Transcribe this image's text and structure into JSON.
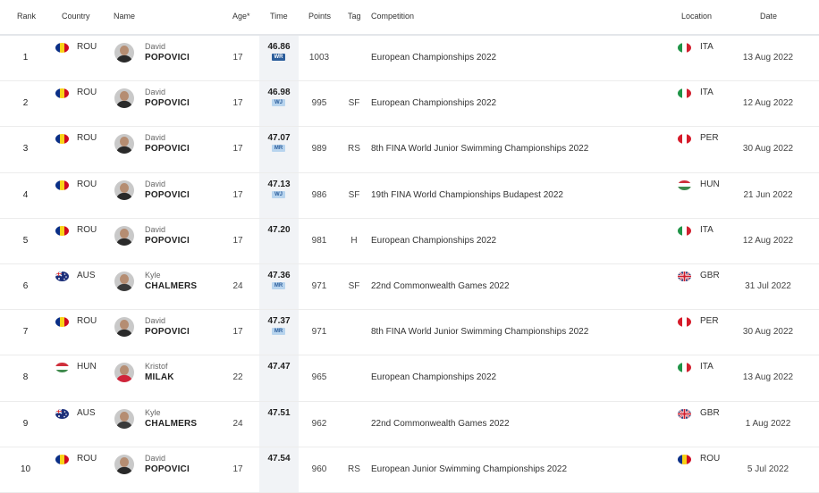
{
  "header": {
    "rank": "Rank",
    "country": "Country",
    "name": "Name",
    "age": "Age*",
    "time": "Time",
    "points": "Points",
    "tag": "Tag",
    "competition": "Competition",
    "location": "Location",
    "date": "Date"
  },
  "rows": [
    {
      "rank": "1",
      "country": "ROU",
      "country_flag": "flag-romania",
      "first": "David",
      "last": "POPOVICI",
      "age": "17",
      "time": "46.86",
      "record": "WR",
      "record_style": "strong",
      "points": "1003",
      "tag": "",
      "competition": "European Championships 2022",
      "location": "ITA",
      "location_flag": "flag-italy",
      "date": "13 Aug 2022"
    },
    {
      "rank": "2",
      "country": "ROU",
      "country_flag": "flag-romania",
      "first": "David",
      "last": "POPOVICI",
      "age": "17",
      "time": "46.98",
      "record": "WJ",
      "record_style": "light",
      "points": "995",
      "tag": "SF",
      "competition": "European Championships 2022",
      "location": "ITA",
      "location_flag": "flag-italy",
      "date": "12 Aug 2022"
    },
    {
      "rank": "3",
      "country": "ROU",
      "country_flag": "flag-romania",
      "first": "David",
      "last": "POPOVICI",
      "age": "17",
      "time": "47.07",
      "record": "MR",
      "record_style": "light",
      "points": "989",
      "tag": "RS",
      "competition": "8th FINA World Junior Swimming Championships 2022",
      "location": "PER",
      "location_flag": "flag-peru",
      "date": "30 Aug 2022"
    },
    {
      "rank": "4",
      "country": "ROU",
      "country_flag": "flag-romania",
      "first": "David",
      "last": "POPOVICI",
      "age": "17",
      "time": "47.13",
      "record": "WJ",
      "record_style": "light",
      "points": "986",
      "tag": "SF",
      "competition": "19th FINA World Championships Budapest 2022",
      "location": "HUN",
      "location_flag": "flag-hungary",
      "date": "21 Jun 2022"
    },
    {
      "rank": "5",
      "country": "ROU",
      "country_flag": "flag-romania",
      "first": "David",
      "last": "POPOVICI",
      "age": "17",
      "time": "47.20",
      "record": "",
      "record_style": "",
      "points": "981",
      "tag": "H",
      "competition": "European Championships 2022",
      "location": "ITA",
      "location_flag": "flag-italy",
      "date": "12 Aug 2022"
    },
    {
      "rank": "6",
      "country": "AUS",
      "country_flag": "flag-australia",
      "first": "Kyle",
      "last": "CHALMERS",
      "age": "24",
      "time": "47.36",
      "record": "MR",
      "record_style": "light",
      "points": "971",
      "tag": "SF",
      "competition": "22nd Commonwealth Games 2022",
      "location": "GBR",
      "location_flag": "flag-uk",
      "date": "31 Jul 2022"
    },
    {
      "rank": "7",
      "country": "ROU",
      "country_flag": "flag-romania",
      "first": "David",
      "last": "POPOVICI",
      "age": "17",
      "time": "47.37",
      "record": "MR",
      "record_style": "light",
      "points": "971",
      "tag": "",
      "competition": "8th FINA World Junior Swimming Championships 2022",
      "location": "PER",
      "location_flag": "flag-peru",
      "date": "30 Aug 2022"
    },
    {
      "rank": "8",
      "country": "HUN",
      "country_flag": "flag-hungary",
      "first": "Kristof",
      "last": "MILAK",
      "age": "22",
      "time": "47.47",
      "record": "",
      "record_style": "",
      "points": "965",
      "tag": "",
      "competition": "European Championships 2022",
      "location": "ITA",
      "location_flag": "flag-italy",
      "date": "13 Aug 2022"
    },
    {
      "rank": "9",
      "country": "AUS",
      "country_flag": "flag-australia",
      "first": "Kyle",
      "last": "CHALMERS",
      "age": "24",
      "time": "47.51",
      "record": "",
      "record_style": "",
      "points": "962",
      "tag": "",
      "competition": "22nd Commonwealth Games 2022",
      "location": "GBR",
      "location_flag": "flag-uk",
      "date": "1 Aug 2022"
    },
    {
      "rank": "10",
      "country": "ROU",
      "country_flag": "flag-romania",
      "first": "David",
      "last": "POPOVICI",
      "age": "17",
      "time": "47.54",
      "record": "",
      "record_style": "",
      "points": "960",
      "tag": "RS",
      "competition": "European Junior Swimming Championships 2022",
      "location": "ROU",
      "location_flag": "flag-romania",
      "date": "5 Jul 2022"
    }
  ],
  "colors": {
    "record_strong": "#2b5d9b",
    "record_light": "#b8d4ee",
    "time_column_bg": "#f1f3f6"
  }
}
